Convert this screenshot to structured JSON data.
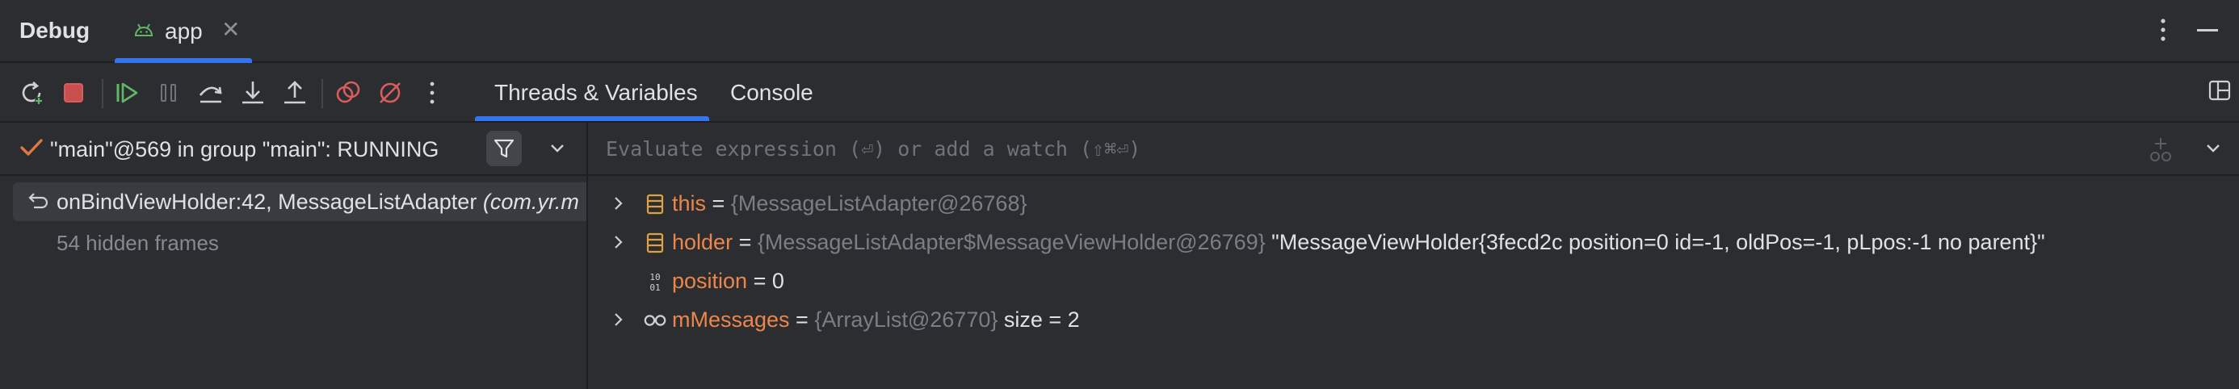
{
  "titlebar": {
    "title": "Debug",
    "tab": {
      "label": "app",
      "close": "✕"
    }
  },
  "toolbar": {
    "icons": [
      "rerun-icon",
      "stop-icon",
      "resume-icon",
      "pause-icon",
      "step-over-icon",
      "step-into-icon",
      "step-out-icon",
      "view-breakpoints-icon",
      "mute-breakpoints-icon",
      "more-icon"
    ],
    "tabs": [
      {
        "label": "Threads & Variables",
        "active": true
      },
      {
        "label": "Console",
        "active": false
      }
    ]
  },
  "threads": {
    "selected_thread": "\"main\"@569 in group \"main\": RUNNING",
    "frames": [
      {
        "method": "onBindViewHolder:42, MessageListAdapter ",
        "package": "(com.yr.m"
      }
    ],
    "hidden_frames": "54 hidden frames"
  },
  "evaluate": {
    "placeholder": "Evaluate expression (⏎) or add a watch (⇧⌘⏎)"
  },
  "variables": [
    {
      "name": "this",
      "eq": " = ",
      "type": "{MessageListAdapter@26768}",
      "value": "",
      "icon": "field-icon",
      "expandable": true
    },
    {
      "name": "holder",
      "eq": " = ",
      "type": "{MessageListAdapter$MessageViewHolder@26769}",
      "value": " \"MessageViewHolder{3fecd2c position=0 id=-1, oldPos=-1, pLpos:-1 no parent}\"",
      "icon": "field-icon",
      "expandable": true
    },
    {
      "name": "position",
      "eq": " = ",
      "type": "",
      "value": "0",
      "icon": "primitive-icon",
      "expandable": false
    },
    {
      "name": "mMessages",
      "eq": " = ",
      "type": "{ArrayList@26770}",
      "value": "  size = 2",
      "icon": "watch-glasses-icon",
      "expandable": true
    }
  ],
  "colors": {
    "background": "#2b2d30",
    "accent": "#3574f0",
    "variable_name": "#ed864a",
    "type_gray": "#7a7e85",
    "running_check": "#e0783f",
    "resume_green": "#5fb865",
    "stop_red": "#db5c5c"
  }
}
